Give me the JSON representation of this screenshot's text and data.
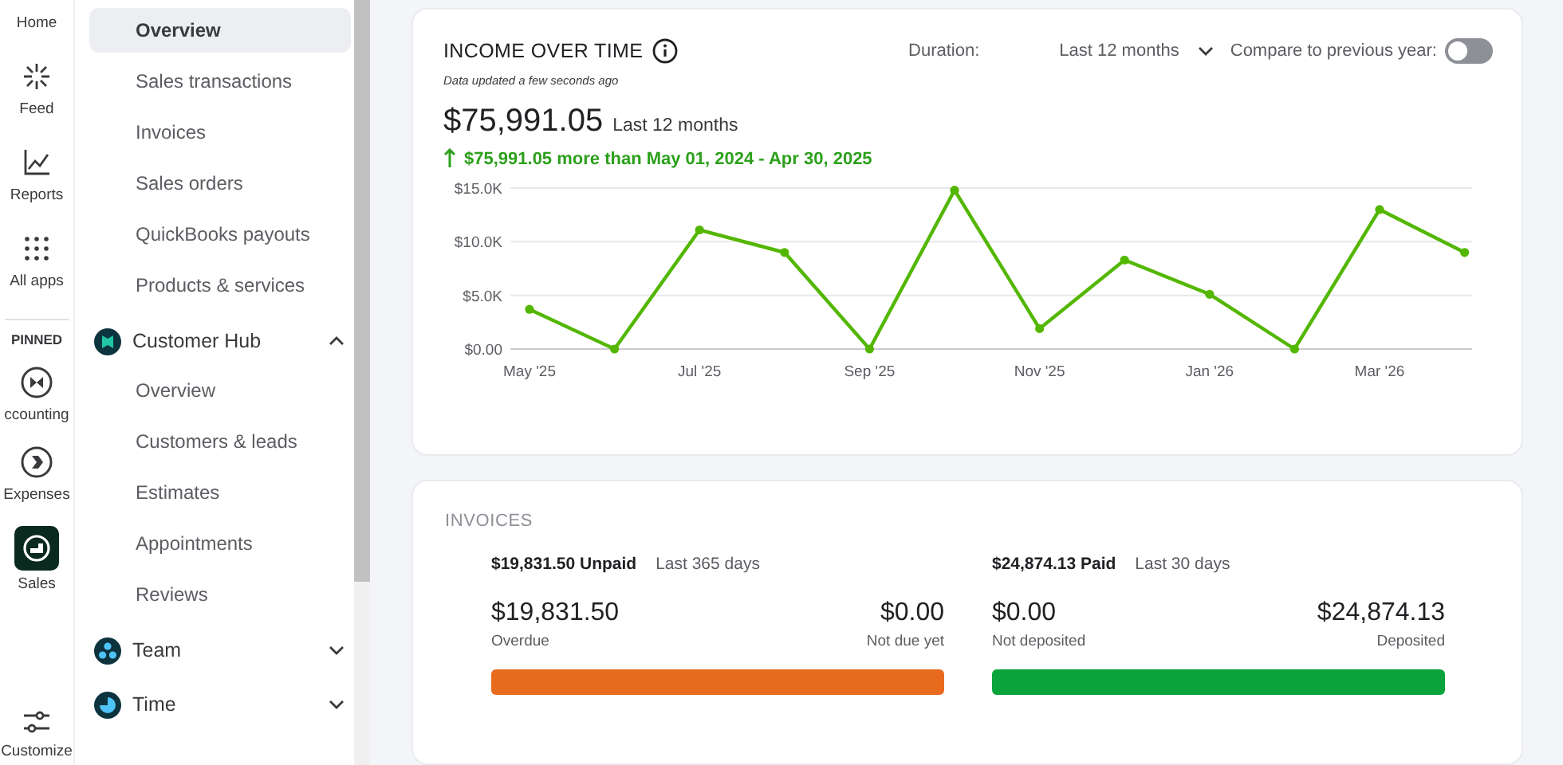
{
  "rail": {
    "items": [
      {
        "label": "Home",
        "selected": false
      },
      {
        "label": "Feed",
        "selected": false
      },
      {
        "label": "Reports",
        "selected": false
      },
      {
        "label": "All apps",
        "selected": false
      }
    ],
    "pinned_heading": "PINNED",
    "pinned": [
      {
        "label": "ccounting",
        "selected": false
      },
      {
        "label": "Expenses",
        "selected": false
      },
      {
        "label": "Sales",
        "selected": true
      }
    ],
    "customize": "Customize"
  },
  "sidebar": {
    "items": [
      {
        "label": "Overview",
        "selected": true
      },
      {
        "label": "Sales transactions",
        "selected": false
      },
      {
        "label": "Invoices",
        "selected": false
      },
      {
        "label": "Sales orders",
        "selected": false
      },
      {
        "label": "QuickBooks payouts",
        "selected": false
      },
      {
        "label": "Products & services",
        "selected": false
      }
    ],
    "groups": [
      {
        "label": "Customer Hub",
        "expanded": true,
        "children": [
          {
            "label": "Overview",
            "selected": false
          },
          {
            "label": "Customers & leads",
            "selected": false
          },
          {
            "label": "Estimates",
            "selected": false
          },
          {
            "label": "Appointments",
            "selected": false
          },
          {
            "label": "Reviews",
            "selected": false
          }
        ]
      },
      {
        "label": "Team",
        "expanded": false
      },
      {
        "label": "Time",
        "expanded": false
      }
    ]
  },
  "income": {
    "title": "INCOME OVER TIME",
    "updated": "Data updated a few seconds ago",
    "duration_label": "Duration:",
    "duration": "Last 12 months",
    "compare_label": "Compare to previous year:",
    "compare_on": false,
    "total": "$75,991.05",
    "total_period": "Last 12 months",
    "change": "$75,991.05 more than May 01, 2024 - Apr 30, 2025",
    "chart_data": {
      "type": "line",
      "categories": [
        "May '25",
        null,
        "Jul '25",
        null,
        "Sep '25",
        null,
        "Nov '25",
        null,
        "Jan '26",
        null,
        "Mar '26",
        null
      ],
      "series": [
        {
          "color": "#53b700",
          "marker": true,
          "values": [
            3700,
            0,
            11100,
            9000,
            0,
            14800,
            1900,
            8300,
            5100,
            0,
            13000,
            9000
          ]
        }
      ],
      "ylim": [
        0,
        15000
      ],
      "yticks": [
        {
          "value": 0,
          "label": "$0.00"
        },
        {
          "value": 5000,
          "label": "$5.0K"
        },
        {
          "value": 10000,
          "label": "$10.0K"
        },
        {
          "value": 15000,
          "label": "$15.0K"
        }
      ]
    }
  },
  "invoices": {
    "title": "INVOICES",
    "panels": [
      {
        "amount": "$19,831.50",
        "status": "Unpaid",
        "period": "Last 365 days",
        "left_value": "$19,831.50",
        "left_label": "Overdue",
        "right_value": "$0.00",
        "right_label": "Not due yet",
        "level": 1,
        "color": "#e86a1d"
      },
      {
        "amount": "$24,874.13",
        "status": "Paid",
        "period": "Last 30 days",
        "left_value": "$0.00",
        "left_label": "Not deposited",
        "right_value": "$24,874.13",
        "right_label": "Deposited",
        "level": 1,
        "color": "#0aa33c"
      }
    ]
  }
}
